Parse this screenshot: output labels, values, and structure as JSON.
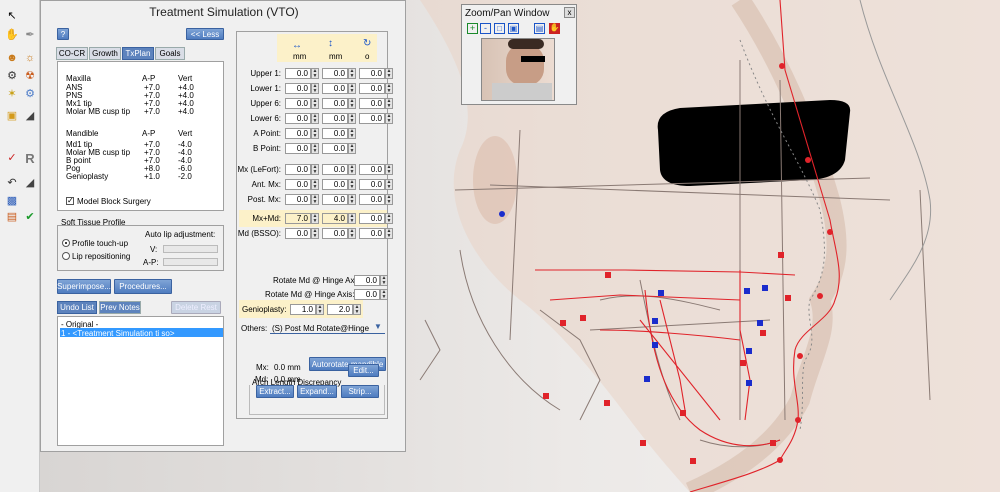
{
  "window": {
    "title": "Treatment Simulation (VTO)",
    "help_label": "?",
    "less_label": "<< Less"
  },
  "tabs": [
    {
      "label": "CO-CR",
      "active": false
    },
    {
      "label": "Growth",
      "active": false
    },
    {
      "label": "TxPlan",
      "active": true
    },
    {
      "label": "Goals",
      "active": false
    }
  ],
  "summary": {
    "header": [
      "",
      "A-P",
      "Vert"
    ],
    "maxilla_title": "Maxilla",
    "maxilla": [
      {
        "name": "ANS",
        "ap": "+7.0",
        "vert": "+4.0"
      },
      {
        "name": "PNS",
        "ap": "+7.0",
        "vert": "+4.0"
      },
      {
        "name": "Mx1 tip",
        "ap": "+7.0",
        "vert": "+4.0"
      },
      {
        "name": "Molar MB cusp tip",
        "ap": "+7.0",
        "vert": "+4.0"
      }
    ],
    "mandible_title": "Mandible",
    "mandible": [
      {
        "name": "Md1 tip",
        "ap": "+7.0",
        "vert": "-4.0"
      },
      {
        "name": "Molar MB cusp tip",
        "ap": "+7.0",
        "vert": "-4.0"
      },
      {
        "name": "B point",
        "ap": "+7.0",
        "vert": "-4.0"
      },
      {
        "name": "Pog",
        "ap": "+8.0",
        "vert": "-6.0"
      },
      {
        "name": "Genioplasty",
        "ap": "+1.0",
        "vert": "-2.0"
      }
    ],
    "model_block_label": "Model Block Surgery",
    "model_block_checked": true
  },
  "soft_tissue": {
    "title": "Soft Tissue Profile",
    "profile_label": "Profile touch-up",
    "lip_label": "Lip repositioning",
    "auto_lip_label": "Auto lip adjustment:",
    "v_label": "V:",
    "ap_label": "A-P:"
  },
  "buttons": {
    "superimpose": "Superimpose...",
    "procedures": "Procedures...",
    "undo_list": "Undo List",
    "prev_notes": "Prev Notes",
    "delete_rest": "Delete Rest",
    "autorotate": "Autorotate mandible",
    "edit": "Edit...",
    "extract": "Extract...",
    "expand": "Expand...",
    "strip": "Strip..."
  },
  "undo": {
    "items": [
      "- Original -",
      "1 - <Treatment Simulation ti so>"
    ],
    "selected": 1
  },
  "movements": {
    "col_units": [
      "mm",
      "mm",
      "o"
    ],
    "rows": [
      {
        "label": "Upper 1:",
        "v": [
          "0.0",
          "0.0",
          "0.0"
        ]
      },
      {
        "label": "Lower 1:",
        "v": [
          "0.0",
          "0.0",
          "0.0"
        ]
      },
      {
        "label": "Upper 6:",
        "v": [
          "0.0",
          "0.0",
          "0.0"
        ]
      },
      {
        "label": "Lower 6:",
        "v": [
          "0.0",
          "0.0",
          "0.0"
        ]
      },
      {
        "label": "A Point:",
        "v": [
          "0.0",
          "0.0"
        ]
      },
      {
        "label": "B Point:",
        "v": [
          "0.0",
          "0.0"
        ]
      },
      {
        "label": "Mx (LeFort):",
        "v": [
          "0.0",
          "0.0",
          "0.0"
        ]
      },
      {
        "label": "Ant. Mx:",
        "v": [
          "0.0",
          "0.0",
          "0.0"
        ]
      },
      {
        "label": "Post. Mx:",
        "v": [
          "0.0",
          "0.0",
          "0.0"
        ]
      },
      {
        "label": "Mx+Md:",
        "v": [
          "7.0",
          "4.0",
          "0.0"
        ]
      },
      {
        "label": "Md (BSSO):",
        "v": [
          "0.0",
          "0.0",
          "0.0"
        ]
      }
    ],
    "rotate_hinge_label": "Rotate Md @ Hinge Axis:",
    "rotate_hinge_value": "0.0",
    "rotate_hinge2_label": "Rotate Md @ Hinge Axis:",
    "rotate_hinge2_value": "0.0",
    "genioplasty_label": "Genioplasty:",
    "genioplasty_values": [
      "1.0",
      "2.0"
    ],
    "others_label": "Others:",
    "others_value": "(S) Post Md Rotate@Hinge"
  },
  "arch": {
    "title": "Arch Length Discrepancy",
    "mx_label": "Mx:",
    "mx_value": "0.0 mm",
    "md_label": "Md:",
    "md_value": "0.0 mm"
  },
  "zoom": {
    "title": "Zoom/Pan Window",
    "close": "x"
  },
  "colors": {
    "accent": "#5d83bd",
    "highlight": "#fcf1c9",
    "trace_red": "#e0232a",
    "landmark_blue": "#1a2ccc"
  }
}
